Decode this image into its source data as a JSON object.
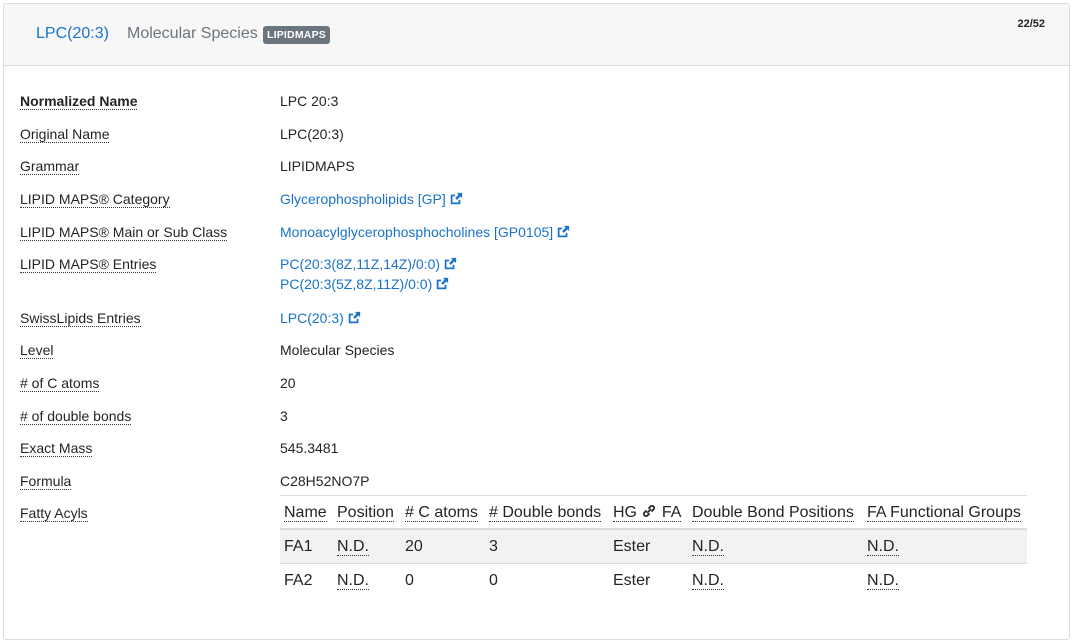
{
  "header": {
    "title": "LPC(20:3)",
    "level": "Molecular Species",
    "badge": "LIPIDMAPS",
    "counter": "22/52"
  },
  "fields": {
    "normalized_name": {
      "label": "Normalized Name",
      "value": "LPC 20:3"
    },
    "original_name": {
      "label": "Original Name",
      "value": "LPC(20:3)"
    },
    "grammar": {
      "label": "Grammar",
      "value": "LIPIDMAPS"
    },
    "category": {
      "label": "LIPID MAPS® Category",
      "value": "Glycerophospholipids [GP]"
    },
    "main_class": {
      "label": "LIPID MAPS® Main or Sub Class",
      "value": "Monoacylglycerophosphocholines [GP0105]"
    },
    "entries": {
      "label": "LIPID MAPS® Entries",
      "values": [
        "PC(20:3(8Z,11Z,14Z)/0:0)",
        "PC(20:3(5Z,8Z,11Z)/0:0)"
      ]
    },
    "swisslipids": {
      "label": "SwissLipids Entries",
      "value": "LPC(20:3)"
    },
    "level": {
      "label": "Level",
      "value": "Molecular Species"
    },
    "c_atoms": {
      "label": "# of C atoms",
      "value": "20"
    },
    "double_bonds": {
      "label": "# of double bonds",
      "value": "3"
    },
    "exact_mass": {
      "label": "Exact Mass",
      "value": "545.3481"
    },
    "formula": {
      "label": "Formula",
      "value": "C28H52NO7P"
    },
    "fatty_acyls": {
      "label": "Fatty Acyls"
    }
  },
  "fa_table": {
    "headers": [
      "Name",
      "Position",
      "# C atoms",
      "# Double bonds",
      "HG",
      "FA",
      "Double Bond Positions",
      "FA Functional Groups"
    ],
    "rows": [
      [
        "FA1",
        "N.D.",
        "20",
        "3",
        "Ester",
        "N.D.",
        "N.D."
      ],
      [
        "FA2",
        "N.D.",
        "0",
        "0",
        "Ester",
        "N.D.",
        "N.D."
      ]
    ]
  },
  "colors": {
    "link": "#1a73c9",
    "badge": "#6c757d",
    "header_bg": "#f7f7f7"
  },
  "icons": {
    "external": "external-link-icon",
    "link": "link-chain-icon"
  }
}
